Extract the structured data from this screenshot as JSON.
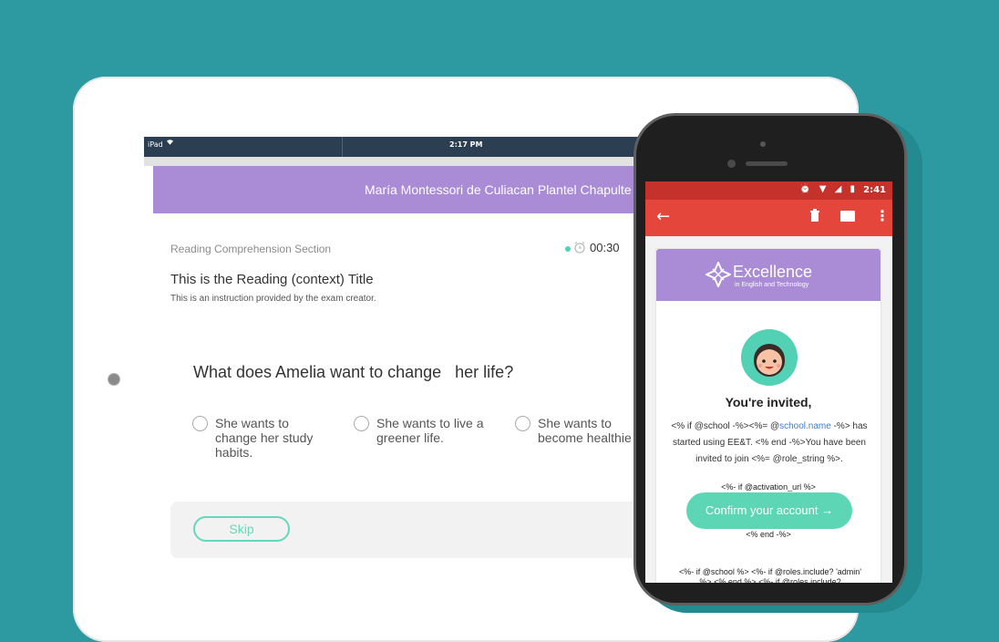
{
  "tablet": {
    "status": {
      "device": "iPad",
      "time": "2:17 PM"
    },
    "header": {
      "school_name": "María Montessori de Culiacan Plantel Chapulte"
    },
    "section_label": "Reading Comprehension Section",
    "timer": "00:30",
    "reading_title": "This is the Reading (context) Title",
    "instruction": "This is an instruction provided by the exam creator.",
    "question": "What does Amelia want to change   her life?",
    "options": [
      {
        "label": "She wants to change her study habits."
      },
      {
        "label": "She wants to live a greener life."
      },
      {
        "label": "She wants to become healthie"
      }
    ],
    "skip_label": "Skip"
  },
  "phone": {
    "status": {
      "time": "2:41",
      "icons": "⏰ ▼ ◢ ▮"
    },
    "toolbar": {
      "back": "←",
      "trash": "🗑",
      "more": "⋮"
    },
    "brand": {
      "name": "Excellence",
      "tagline": "in English and Technology"
    },
    "email": {
      "heading": "You're invited,",
      "line1_a": "<% if @school -%><%= @",
      "line1_link": "school.name",
      "line1_b": " -%> has started using EE&T. <% end -%>You have been invited to join <%= @role_string %>.",
      "activation_if": "<%- if @activation_url %>",
      "confirm_label": "Confirm your account →",
      "activation_end": "<% end -%>",
      "bottom_tpl": "<%- if @school %> <%- if @roles.include? 'admin' %> <% end %> <%- if @roles.include?"
    }
  },
  "colors": {
    "background": "#2c9aa0",
    "accent": "#a98bd6",
    "teal": "#5dd6b5",
    "gmail_red": "#e4463b"
  }
}
